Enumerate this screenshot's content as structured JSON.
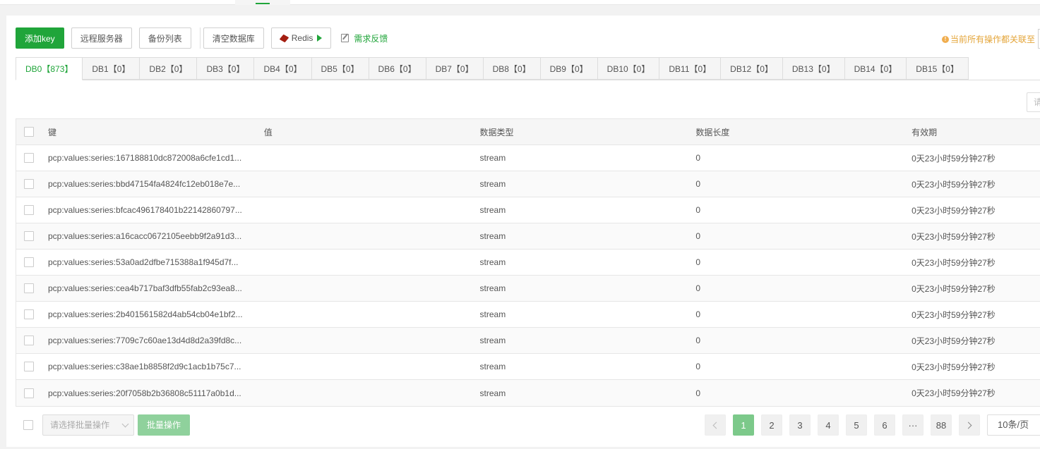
{
  "toolbar": {
    "add_key": "添加key",
    "remote_server": "远程服务器",
    "backup_list": "备份列表",
    "clear_db": "清空数据库",
    "redis": "Redis",
    "feedback": "需求反馈"
  },
  "notice": {
    "text": "当前所有操作都关联至",
    "icon": "info-icon"
  },
  "search": {
    "placeholder": "请"
  },
  "tabs": [
    {
      "label": "DB0【873】",
      "active": true
    },
    {
      "label": "DB1【0】"
    },
    {
      "label": "DB2【0】"
    },
    {
      "label": "DB3【0】"
    },
    {
      "label": "DB4【0】"
    },
    {
      "label": "DB5【0】"
    },
    {
      "label": "DB6【0】"
    },
    {
      "label": "DB7【0】"
    },
    {
      "label": "DB8【0】"
    },
    {
      "label": "DB9【0】"
    },
    {
      "label": "DB10【0】"
    },
    {
      "label": "DB11【0】"
    },
    {
      "label": "DB12【0】"
    },
    {
      "label": "DB13【0】"
    },
    {
      "label": "DB14【0】"
    },
    {
      "label": "DB15【0】"
    }
  ],
  "table": {
    "headers": {
      "key": "键",
      "value": "值",
      "type": "数据类型",
      "length": "数据长度",
      "ttl": "有效期"
    },
    "rows": [
      {
        "key": "pcp:values:series:167188810dc872008a6cfe1cd1...",
        "value": "",
        "type": "stream",
        "length": "0",
        "ttl": "0天23小时59分钟27秒"
      },
      {
        "key": "pcp:values:series:bbd47154fa4824fc12eb018e7e...",
        "value": "",
        "type": "stream",
        "length": "0",
        "ttl": "0天23小时59分钟27秒"
      },
      {
        "key": "pcp:values:series:bfcac496178401b22142860797...",
        "value": "",
        "type": "stream",
        "length": "0",
        "ttl": "0天23小时59分钟27秒"
      },
      {
        "key": "pcp:values:series:a16cacc0672105eebb9f2a91d3...",
        "value": "",
        "type": "stream",
        "length": "0",
        "ttl": "0天23小时59分钟27秒"
      },
      {
        "key": "pcp:values:series:53a0ad2dfbe715388a1f945d7f...",
        "value": "",
        "type": "stream",
        "length": "0",
        "ttl": "0天23小时59分钟27秒"
      },
      {
        "key": "pcp:values:series:cea4b717baf3dfb55fab2c93ea8...",
        "value": "",
        "type": "stream",
        "length": "0",
        "ttl": "0天23小时59分钟27秒"
      },
      {
        "key": "pcp:values:series:2b401561582d4ab54cb04e1bf2...",
        "value": "",
        "type": "stream",
        "length": "0",
        "ttl": "0天23小时59分钟27秒"
      },
      {
        "key": "pcp:values:series:7709c7c60ae13d4d8d2a39fd8c...",
        "value": "",
        "type": "stream",
        "length": "0",
        "ttl": "0天23小时59分钟27秒"
      },
      {
        "key": "pcp:values:series:c38ae1b8858f2d9c1acb1b75c7...",
        "value": "",
        "type": "stream",
        "length": "0",
        "ttl": "0天23小时59分钟27秒"
      },
      {
        "key": "pcp:values:series:20f7058b2b36808c51117a0b1d...",
        "value": "",
        "type": "stream",
        "length": "0",
        "ttl": "0天23小时59分钟27秒"
      }
    ]
  },
  "footer": {
    "batch_select_placeholder": "请选择批量操作",
    "batch_button": "批量操作",
    "pages": [
      "1",
      "2",
      "3",
      "4",
      "5",
      "6",
      "···",
      "88"
    ],
    "current_page": "1",
    "per_page": "10条/页"
  },
  "colors": {
    "accent": "#20a53a",
    "notice": "#e4a539"
  }
}
